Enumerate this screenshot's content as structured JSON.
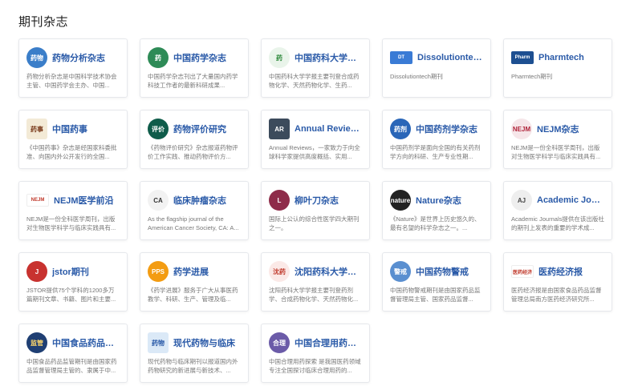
{
  "section": {
    "title": "期刊杂志"
  },
  "journals": [
    {
      "title": "药物分析杂志",
      "desc": "药物分析杂志是中国科学技术协会主管、中国药学会主办、中国...",
      "icon": "yaowu-fenxi-logo-icon",
      "logo_text": "药物",
      "bg": "#3b7ec9",
      "fg": "#ffffff",
      "shape": "circle"
    },
    {
      "title": "中国药学杂志",
      "desc": "中国药学杂志刊出了大量国内药学科技工作者的最新科研成果...",
      "icon": "zhongguo-yaoxue-logo-icon",
      "logo_text": "药",
      "bg": "#2e8b57",
      "fg": "#ffffff",
      "shape": "circle"
    },
    {
      "title": "中国药科大学学报",
      "desc": "中国药科大学学报主要刊登合成药物化学、天然药物化学、生药...",
      "icon": "cpu-emblem-icon",
      "logo_text": "药",
      "bg": "#e9f4ea",
      "fg": "#2f8a3c",
      "shape": "circle"
    },
    {
      "title": "Dissolutiontech",
      "desc": "Dissolutiontech期刊",
      "icon": "dissolutiontech-logo-icon",
      "logo_text": "DT",
      "bg": "#3a7bd5",
      "fg": "#ffffff",
      "shape": "wide"
    },
    {
      "title": "Pharmtech",
      "desc": "Pharmtech期刊",
      "icon": "pharmtech-logo-icon",
      "logo_text": "Pharm",
      "bg": "#1d4f91",
      "fg": "#ffffff",
      "shape": "wide"
    },
    {
      "title": "中国药事",
      "desc": "《中国药事》杂志是经国家科委批准、向国内外公开发行的全国...",
      "icon": "zhongguo-yaoshi-logo-icon",
      "logo_text": "药事",
      "bg": "#f3ead6",
      "fg": "#7a3b1c",
      "shape": "square"
    },
    {
      "title": "药物评价研究",
      "desc": "《药物评价研究》杂志报道药物评价工作实践、推动药物评价方...",
      "icon": "yaowu-pingjia-logo-icon",
      "logo_text": "评价",
      "bg": "#0f5c4a",
      "fg": "#ffffff",
      "shape": "circle"
    },
    {
      "title": "Annual Reviews...",
      "desc": "Annual Reviews，一家致力于向全球科学家提供高度概括、实用...",
      "icon": "annual-reviews-logo-icon",
      "logo_text": "AR",
      "bg": "#3c4b5c",
      "fg": "#ffffff",
      "shape": "square"
    },
    {
      "title": "中国药剂学杂志",
      "desc": "中国药剂学是面向全国的有关药剂学方向的科研、生产专业性期...",
      "icon": "yaojixue-logo-icon",
      "logo_text": "药剂",
      "bg": "#2a66b8",
      "fg": "#ffffff",
      "shape": "circle"
    },
    {
      "title": "NEJM杂志",
      "desc": "NEJM是一份全科医学周刊，出版对生物医学科学与临床实践具有...",
      "icon": "nejm-emblem-icon",
      "logo_text": "NEJM",
      "bg": "#f6e6e9",
      "fg": "#b0243a",
      "shape": "circle"
    },
    {
      "title": "NEJM医学前沿",
      "desc": "NEJM是一份全科医学周刊，出版对生物医学科学与临床实践具有...",
      "icon": "nejm-frontier-logo-icon",
      "logo_text": "NEJM",
      "bg": "#ffffff",
      "fg": "#c0392b",
      "shape": "wide"
    },
    {
      "title": "临床肿瘤杂志",
      "desc": "As the flagship journal of the American Cancer Society, CA: A...",
      "icon": "cancer-journal-logo-icon",
      "logo_text": "CA",
      "bg": "#f2f2f2",
      "fg": "#333333",
      "shape": "circle"
    },
    {
      "title": "柳叶刀杂志",
      "desc": "国际上公认的综合性医学四大期刊之一。",
      "icon": "lancet-logo-icon",
      "logo_text": "L",
      "bg": "#8e2c4a",
      "fg": "#ffffff",
      "shape": "circle"
    },
    {
      "title": "Nature杂志",
      "desc": "《Nature》是世界上历史悠久的、最有名望的科学杂志之一。...",
      "icon": "nature-logo-icon",
      "logo_text": "nature",
      "bg": "#222222",
      "fg": "#ffffff",
      "shape": "circle"
    },
    {
      "title": "Academic Journ...",
      "desc": "Academic Journals提供在该出版社的期刊上发表的重要的学术成...",
      "icon": "academic-journals-logo-icon",
      "logo_text": "AJ",
      "bg": "#eeeeee",
      "fg": "#444444",
      "shape": "circle"
    },
    {
      "title": "jstor期刊",
      "desc": "JSTOR提供75个学科的1200多万篇期刊文章、书籍、图片和主要...",
      "icon": "jstor-logo-icon",
      "logo_text": "J",
      "bg": "#c8322f",
      "fg": "#ffffff",
      "shape": "circle"
    },
    {
      "title": "药学进展",
      "desc": "《药学进展》服务于广大从事医药教学、科研、生产、管理及临...",
      "icon": "pps-logo-icon",
      "logo_text": "PPS",
      "bg": "#f39c12",
      "fg": "#ffffff",
      "shape": "circle"
    },
    {
      "title": "沈阳药科大学学报",
      "desc": "沈阳药科大学学报主要刊登药剂学、合成药物化学、天然药物化...",
      "icon": "syphu-emblem-icon",
      "logo_text": "沈药",
      "bg": "#fbe9e7",
      "fg": "#c0392b",
      "shape": "circle"
    },
    {
      "title": "中国药物警戒",
      "desc": "中国药物警戒期刊是由国家药品监督管理局主管、国家药品监督...",
      "icon": "pharmacovigilance-logo-icon",
      "logo_text": "警戒",
      "bg": "#5a8fd0",
      "fg": "#ffffff",
      "shape": "circle"
    },
    {
      "title": "医药经济报",
      "desc": "医药经济报是由国家食品药品监督管理总局南方医药经济研究所...",
      "icon": "yiyao-jingji-logo-icon",
      "logo_text": "医药经济",
      "bg": "#ffffff",
      "fg": "#c0392b",
      "shape": "wide"
    },
    {
      "title": "中国食品药品监管",
      "desc": "中国食品药品监管期刊是由国家药品监督管理局主管的、隶属于中...",
      "icon": "food-drug-regulation-logo-icon",
      "logo_text": "监管",
      "bg": "#1f3f73",
      "fg": "#ffd86b",
      "shape": "circle"
    },
    {
      "title": "现代药物与临床",
      "desc": "现代药物与临床期刊以报道国内外药物研究的新进展与新技术、...",
      "icon": "modern-drugs-logo-icon",
      "logo_text": "药物",
      "bg": "#dbe9f7",
      "fg": "#2a5aa8",
      "shape": "square"
    },
    {
      "title": "中国合理用药探索",
      "desc": "中国合理用药探索 是我国医药领域专注全国探讨临床合理用药的...",
      "icon": "rational-drug-use-logo-icon",
      "logo_text": "合理",
      "bg": "#6b5ba8",
      "fg": "#ffffff",
      "shape": "circle"
    }
  ]
}
